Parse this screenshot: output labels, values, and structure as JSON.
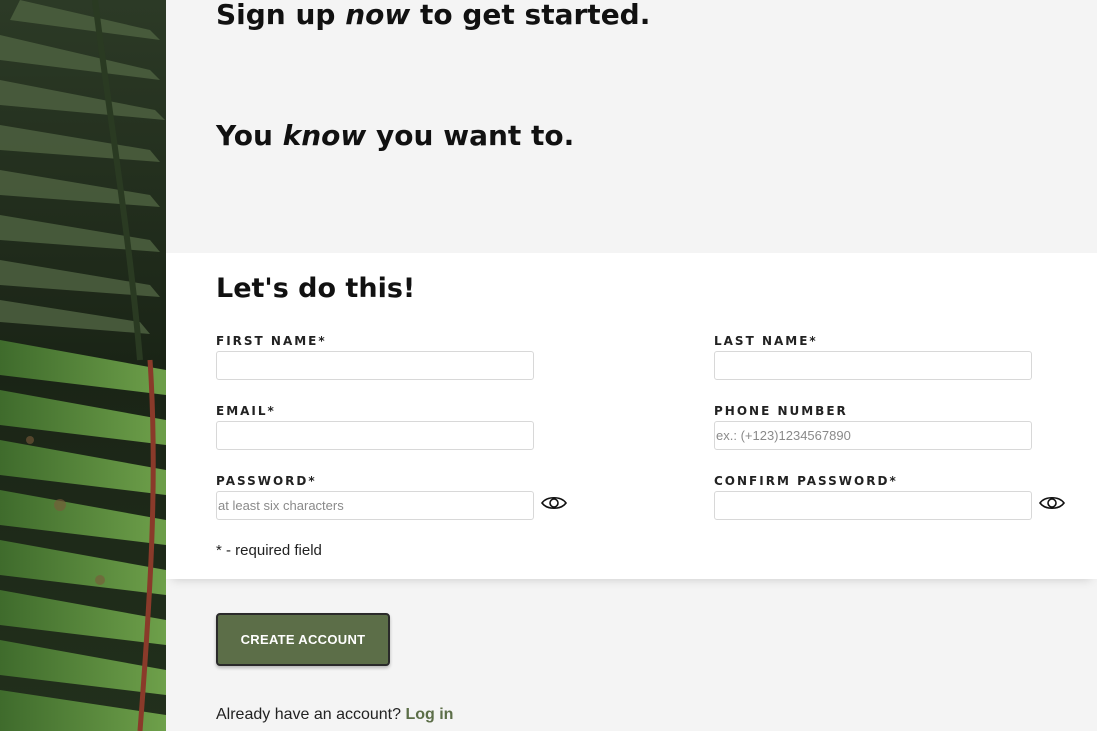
{
  "hero": {
    "line1_pre": "Sign up ",
    "line1_em": "now",
    "line1_post": " to get started.",
    "line2_pre": "You ",
    "line2_em": "know",
    "line2_post": " you want to."
  },
  "form": {
    "heading": "Let's do this!",
    "first_name": {
      "label": "FIRST NAME*",
      "value": "",
      "placeholder": ""
    },
    "last_name": {
      "label": "LAST NAME*",
      "value": "",
      "placeholder": ""
    },
    "email": {
      "label": "EMAIL*",
      "value": "",
      "placeholder": ""
    },
    "phone": {
      "label": "PHONE NUMBER",
      "value": "",
      "placeholder": "ex.: (+123)1234567890"
    },
    "password": {
      "label": "PASSWORD*",
      "value": "",
      "placeholder": "at least six characters"
    },
    "confirm_password": {
      "label": "CONFIRM PASSWORD*",
      "value": "",
      "placeholder": ""
    },
    "required_note": "* - required field"
  },
  "actions": {
    "create_account_label": "CREATE ACCOUNT",
    "login_prompt": "Already have an account?",
    "login_link": "Log in"
  },
  "icons": {
    "password_toggle": "eye-icon",
    "confirm_password_toggle": "eye-icon"
  },
  "colors": {
    "accent": "#5c6e48",
    "background": "#f4f4f4",
    "card": "#ffffff"
  }
}
